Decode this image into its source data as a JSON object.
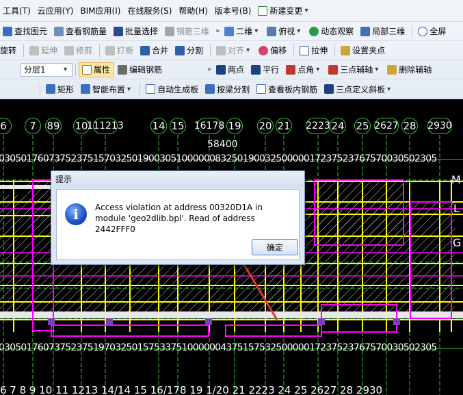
{
  "menu": {
    "items": [
      "工具(T)",
      "云应用(Y)",
      "BIM应用(I)",
      "在线服务(S)",
      "帮助(H)",
      "版本号(B)"
    ],
    "new_change": "新建变更"
  },
  "toolbar1": {
    "find_element": "查找图元",
    "view_rebar_qty": "查看钢筋量",
    "batch_select": "批量选择",
    "rebar_3d": "钢筋三维",
    "view_2d": "二维",
    "bird_view": "俯视",
    "dynamic_observe": "动态观察",
    "local_3d": "局部三维",
    "full_screen": "全屏"
  },
  "toolbar2": {
    "rotate": "旋转",
    "extend": "延伸",
    "trim": "修剪",
    "break": "打断",
    "merge": "合并",
    "split": "分割",
    "align": "对齐",
    "offset": "偏移",
    "stretch": "拉伸",
    "set_clamp_point": "设置夹点"
  },
  "toolbar3": {
    "floor_combo": "分层1",
    "properties": "属性",
    "edit_rebar": "编辑钢筋",
    "two_points": "两点",
    "parallel": "平行",
    "point_angle": "点角",
    "three_point_axis": "三点辅轴",
    "delete_axis": "删除辅轴"
  },
  "toolbar4": {
    "rectangle": "矩形",
    "smart_layout": "智能布置",
    "auto_gen_slab": "自动生成板",
    "split_by_beam": "按梁分割",
    "view_slab_rebar": "查看板内钢筋",
    "three_point_slope": "三点定义斜板"
  },
  "canvas": {
    "top_axes": [
      "6",
      "7",
      "89",
      "10",
      "111213",
      "14",
      "15",
      "16178",
      "19",
      "20",
      "21",
      "2223",
      "24",
      "25",
      "2627",
      "28",
      "2930"
    ],
    "total_dim": "58400",
    "top_dims": "0305017607375237515703250190030510000008325019003250000017237523767570030502305",
    "bottom_dims": "0305017607375237519703250157533751000000437515753250000017237523767570030502305",
    "bottom_axes": "6  7  8 9  10  11 1213  14/14  15  16/178 19  1/20  21  2223  24  25  2627  28  2930",
    "right_letters": [
      "M",
      "L",
      "G"
    ]
  },
  "dialog": {
    "title": "提示",
    "message": "Access violation at address 00320D1A in module 'geo2dlib.bpl'. Read of address 2442FFF0",
    "ok_label": "确定"
  },
  "colors": {
    "beam_yellow": "#ffff00",
    "wall_magenta": "#ff00ff",
    "axis_green": "#31c831",
    "annotation_red": "#e8312a"
  }
}
